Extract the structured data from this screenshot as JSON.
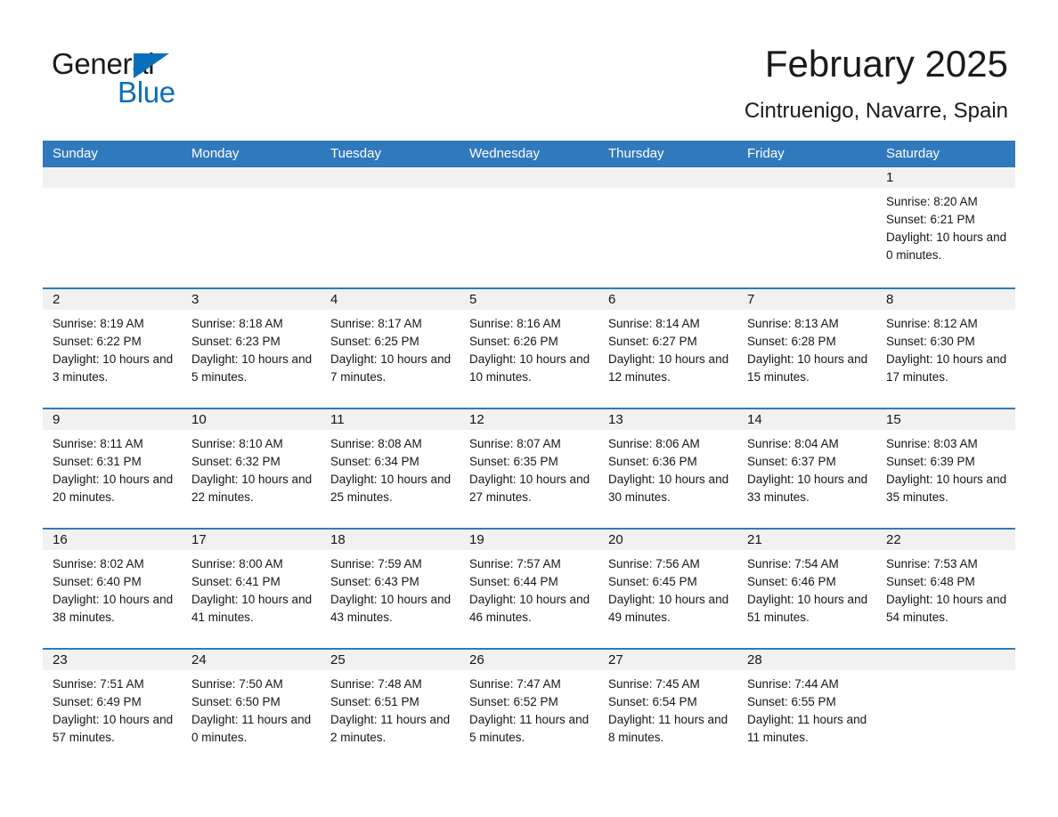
{
  "brand": {
    "name_part1": "General",
    "name_part2": "Blue",
    "accent_color": "#0a6fba"
  },
  "header": {
    "title": "February 2025",
    "subtitle": "Cintruenigo, Navarre, Spain"
  },
  "theme": {
    "header_blue": "#3179bd",
    "day_band_gray": "#f1f1f1",
    "text": "#161616"
  },
  "weekdays": [
    "Sunday",
    "Monday",
    "Tuesday",
    "Wednesday",
    "Thursday",
    "Friday",
    "Saturday"
  ],
  "weeks": [
    [
      {
        "empty": true
      },
      {
        "empty": true
      },
      {
        "empty": true
      },
      {
        "empty": true
      },
      {
        "empty": true
      },
      {
        "empty": true
      },
      {
        "day": "1",
        "sunrise": "Sunrise: 8:20 AM",
        "sunset": "Sunset: 6:21 PM",
        "daylight": "Daylight: 10 hours and 0 minutes."
      }
    ],
    [
      {
        "day": "2",
        "sunrise": "Sunrise: 8:19 AM",
        "sunset": "Sunset: 6:22 PM",
        "daylight": "Daylight: 10 hours and 3 minutes."
      },
      {
        "day": "3",
        "sunrise": "Sunrise: 8:18 AM",
        "sunset": "Sunset: 6:23 PM",
        "daylight": "Daylight: 10 hours and 5 minutes."
      },
      {
        "day": "4",
        "sunrise": "Sunrise: 8:17 AM",
        "sunset": "Sunset: 6:25 PM",
        "daylight": "Daylight: 10 hours and 7 minutes."
      },
      {
        "day": "5",
        "sunrise": "Sunrise: 8:16 AM",
        "sunset": "Sunset: 6:26 PM",
        "daylight": "Daylight: 10 hours and 10 minutes."
      },
      {
        "day": "6",
        "sunrise": "Sunrise: 8:14 AM",
        "sunset": "Sunset: 6:27 PM",
        "daylight": "Daylight: 10 hours and 12 minutes."
      },
      {
        "day": "7",
        "sunrise": "Sunrise: 8:13 AM",
        "sunset": "Sunset: 6:28 PM",
        "daylight": "Daylight: 10 hours and 15 minutes."
      },
      {
        "day": "8",
        "sunrise": "Sunrise: 8:12 AM",
        "sunset": "Sunset: 6:30 PM",
        "daylight": "Daylight: 10 hours and 17 minutes."
      }
    ],
    [
      {
        "day": "9",
        "sunrise": "Sunrise: 8:11 AM",
        "sunset": "Sunset: 6:31 PM",
        "daylight": "Daylight: 10 hours and 20 minutes."
      },
      {
        "day": "10",
        "sunrise": "Sunrise: 8:10 AM",
        "sunset": "Sunset: 6:32 PM",
        "daylight": "Daylight: 10 hours and 22 minutes."
      },
      {
        "day": "11",
        "sunrise": "Sunrise: 8:08 AM",
        "sunset": "Sunset: 6:34 PM",
        "daylight": "Daylight: 10 hours and 25 minutes."
      },
      {
        "day": "12",
        "sunrise": "Sunrise: 8:07 AM",
        "sunset": "Sunset: 6:35 PM",
        "daylight": "Daylight: 10 hours and 27 minutes."
      },
      {
        "day": "13",
        "sunrise": "Sunrise: 8:06 AM",
        "sunset": "Sunset: 6:36 PM",
        "daylight": "Daylight: 10 hours and 30 minutes."
      },
      {
        "day": "14",
        "sunrise": "Sunrise: 8:04 AM",
        "sunset": "Sunset: 6:37 PM",
        "daylight": "Daylight: 10 hours and 33 minutes."
      },
      {
        "day": "15",
        "sunrise": "Sunrise: 8:03 AM",
        "sunset": "Sunset: 6:39 PM",
        "daylight": "Daylight: 10 hours and 35 minutes."
      }
    ],
    [
      {
        "day": "16",
        "sunrise": "Sunrise: 8:02 AM",
        "sunset": "Sunset: 6:40 PM",
        "daylight": "Daylight: 10 hours and 38 minutes."
      },
      {
        "day": "17",
        "sunrise": "Sunrise: 8:00 AM",
        "sunset": "Sunset: 6:41 PM",
        "daylight": "Daylight: 10 hours and 41 minutes."
      },
      {
        "day": "18",
        "sunrise": "Sunrise: 7:59 AM",
        "sunset": "Sunset: 6:43 PM",
        "daylight": "Daylight: 10 hours and 43 minutes."
      },
      {
        "day": "19",
        "sunrise": "Sunrise: 7:57 AM",
        "sunset": "Sunset: 6:44 PM",
        "daylight": "Daylight: 10 hours and 46 minutes."
      },
      {
        "day": "20",
        "sunrise": "Sunrise: 7:56 AM",
        "sunset": "Sunset: 6:45 PM",
        "daylight": "Daylight: 10 hours and 49 minutes."
      },
      {
        "day": "21",
        "sunrise": "Sunrise: 7:54 AM",
        "sunset": "Sunset: 6:46 PM",
        "daylight": "Daylight: 10 hours and 51 minutes."
      },
      {
        "day": "22",
        "sunrise": "Sunrise: 7:53 AM",
        "sunset": "Sunset: 6:48 PM",
        "daylight": "Daylight: 10 hours and 54 minutes."
      }
    ],
    [
      {
        "day": "23",
        "sunrise": "Sunrise: 7:51 AM",
        "sunset": "Sunset: 6:49 PM",
        "daylight": "Daylight: 10 hours and 57 minutes."
      },
      {
        "day": "24",
        "sunrise": "Sunrise: 7:50 AM",
        "sunset": "Sunset: 6:50 PM",
        "daylight": "Daylight: 11 hours and 0 minutes."
      },
      {
        "day": "25",
        "sunrise": "Sunrise: 7:48 AM",
        "sunset": "Sunset: 6:51 PM",
        "daylight": "Daylight: 11 hours and 2 minutes."
      },
      {
        "day": "26",
        "sunrise": "Sunrise: 7:47 AM",
        "sunset": "Sunset: 6:52 PM",
        "daylight": "Daylight: 11 hours and 5 minutes."
      },
      {
        "day": "27",
        "sunrise": "Sunrise: 7:45 AM",
        "sunset": "Sunset: 6:54 PM",
        "daylight": "Daylight: 11 hours and 8 minutes."
      },
      {
        "day": "28",
        "sunrise": "Sunrise: 7:44 AM",
        "sunset": "Sunset: 6:55 PM",
        "daylight": "Daylight: 11 hours and 11 minutes."
      },
      {
        "empty": true
      }
    ]
  ]
}
